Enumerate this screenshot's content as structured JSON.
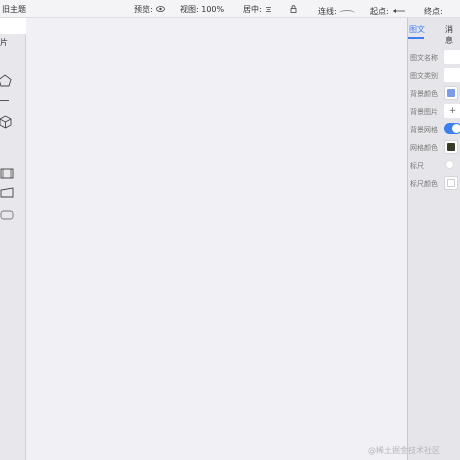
{
  "toolbar": {
    "theme_label": "旧主题",
    "preview_label": "预览:",
    "view_label": "视图: 100%",
    "center_label": "居中:",
    "connect_label": "连线:",
    "start_label": "起点:",
    "end_label": "终点:",
    "icons": [
      "eye-icon",
      "center-align-icon",
      "lock-icon",
      "connector-curve-icon",
      "arrow-left-icon"
    ]
  },
  "left_panel": {
    "tab_label": "片",
    "icons": [
      "pentagon-icon",
      "cube-icon",
      "frame-rect-icon",
      "trapezoid-icon",
      "rounded-rect-icon"
    ]
  },
  "right_panel": {
    "tabs": [
      "图文",
      "消息"
    ],
    "active_tab": 0,
    "properties": {
      "name_label": "图文名称",
      "category_label": "图文类别",
      "bg_color_label": "背景颜色",
      "bg_image_label": "背景图片",
      "bg_grid_label": "背景网格",
      "grid_color_label": "网格颜色",
      "ruler_label": "标尺",
      "ruler_color_label": "标尺颜色",
      "bg_image_add": "+",
      "bg_color": "#7b9ce8",
      "grid_color": "#3a3a2a",
      "ruler_color": "#ffffff",
      "bg_grid_on": true,
      "ruler_on": false,
      "accent": "#3d7ef0"
    }
  },
  "watermark": "@稀土掘金技术社区"
}
